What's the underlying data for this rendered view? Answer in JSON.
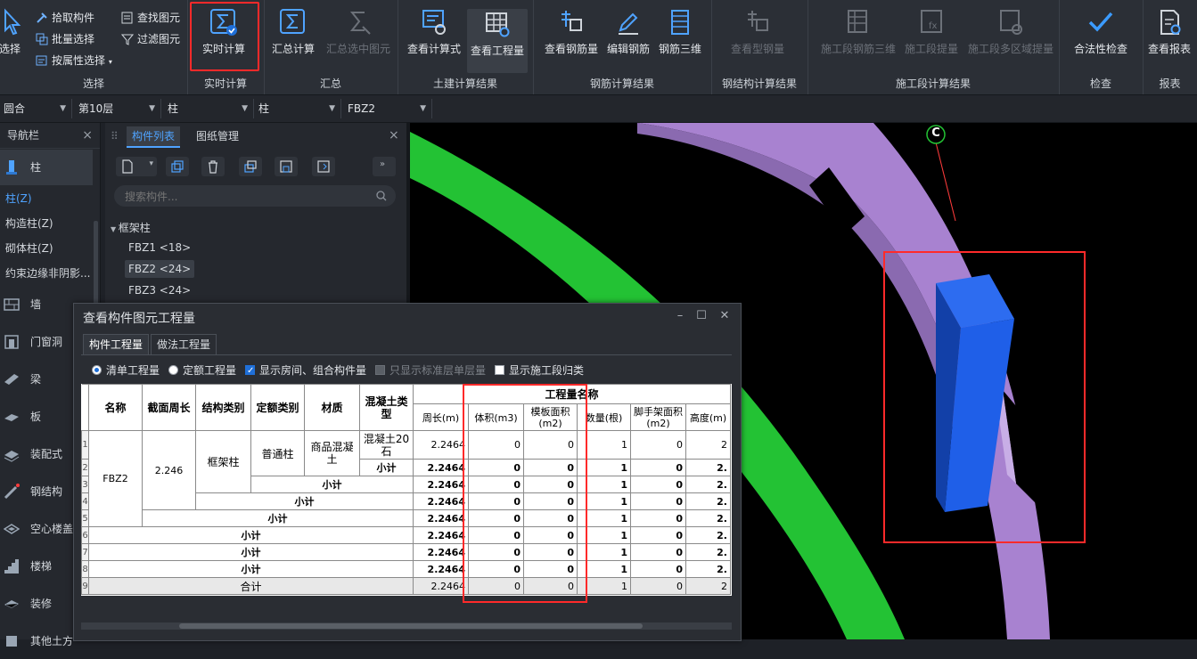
{
  "ribbon": {
    "groups": [
      {
        "caption": "选择",
        "big": [
          {
            "label": "选择"
          }
        ],
        "small": [
          {
            "label": "拾取构件"
          },
          {
            "label": "批量选择"
          },
          {
            "label": "按属性选择"
          },
          {
            "label": "查找图元"
          },
          {
            "label": "过滤图元"
          }
        ]
      },
      {
        "caption": "实时计算",
        "big": [
          {
            "label": "实时计算"
          }
        ]
      },
      {
        "caption": "汇总",
        "big": [
          {
            "label": "汇总计算"
          },
          {
            "label": "汇总选中图元"
          }
        ]
      },
      {
        "caption": "土建计算结果",
        "big": [
          {
            "label": "查看计算式"
          },
          {
            "label": "查看工程量"
          }
        ]
      },
      {
        "caption": "钢筋计算结果",
        "big": [
          {
            "label": "查看钢筋量"
          },
          {
            "label": "编辑钢筋"
          },
          {
            "label": "钢筋三维"
          }
        ]
      },
      {
        "caption": "钢结构计算结果",
        "big": [
          {
            "label": "查看型钢量"
          }
        ]
      },
      {
        "caption": "施工段计算结果",
        "big": [
          {
            "label": "施工段钢筋三维"
          },
          {
            "label": "施工段提量"
          },
          {
            "label": "施工段多区域提量"
          }
        ]
      },
      {
        "caption": "检查",
        "big": [
          {
            "label": "合法性检查"
          }
        ]
      },
      {
        "caption": "报表",
        "big": [
          {
            "label": "查看报表"
          }
        ]
      }
    ],
    "highlight_color": "#ff2a2a"
  },
  "dropdowns": [
    "圆合",
    "第10层",
    "柱",
    "柱",
    "FBZ2"
  ],
  "nav": {
    "title": "导航栏",
    "selected_category": "柱",
    "sub_items": [
      "柱(Z)",
      "构造柱(Z)",
      "砌体柱(Z)",
      "约束边缘非阴影..."
    ],
    "categories": [
      "墙",
      "门窗洞",
      "梁",
      "板",
      "装配式",
      "钢结构",
      "空心楼盖",
      "楼梯",
      "装修",
      "其他土方"
    ]
  },
  "component_list": {
    "tabs": [
      "构件列表",
      "图纸管理"
    ],
    "search_placeholder": "搜索构件...",
    "tree_root": "框架柱",
    "items": [
      "FBZ1 <18>",
      "FBZ2 <24>",
      "FBZ3 <24>"
    ],
    "selected_index": 1
  },
  "viewport": {
    "axis_label": "C"
  },
  "dialog": {
    "title": "查看构件图元工程量",
    "tabs": [
      "构件工程量",
      "做法工程量"
    ],
    "options": [
      {
        "label": "清单工程量",
        "type": "radio",
        "checked": true
      },
      {
        "label": "定额工程量",
        "type": "radio",
        "checked": false
      },
      {
        "label": "显示房间、组合构件量",
        "type": "check",
        "checked": true
      },
      {
        "label": "只显示标准层单层量",
        "type": "check",
        "checked": false,
        "disabled": true
      },
      {
        "label": "显示施工段归类",
        "type": "check",
        "checked": false
      }
    ],
    "table": {
      "headers": {
        "name": "名称",
        "perimeter": "截面周长",
        "struct_type": "结构类别",
        "quota_type": "定额类别",
        "material": "材质",
        "concrete_type": "混凝土类型",
        "group": "工程量名称",
        "cols": [
          "周长(m)",
          "体积(m3)",
          "模板面积(m2)",
          "数量(根)",
          "脚手架面积(m2)",
          "高度(m)"
        ]
      },
      "first": {
        "name": "FBZ2",
        "perimeter": "2.246",
        "struct_type": "框架柱",
        "quota_type": "普通柱",
        "material": "商品混凝土",
        "concrete_type": "混凝土20石"
      },
      "subtotal": "小计",
      "total": "合计",
      "row_numbers": [
        "1",
        "2",
        "3",
        "4",
        "5",
        "6",
        "7",
        "8",
        "9"
      ],
      "rows": [
        [
          "2.2464",
          "0",
          "0",
          "1",
          "0",
          "2"
        ],
        [
          "2.2464",
          "0",
          "0",
          "1",
          "0",
          "2."
        ],
        [
          "2.2464",
          "0",
          "0",
          "1",
          "0",
          "2."
        ],
        [
          "2.2464",
          "0",
          "0",
          "1",
          "0",
          "2."
        ],
        [
          "2.2464",
          "0",
          "0",
          "1",
          "0",
          "2."
        ],
        [
          "2.2464",
          "0",
          "0",
          "1",
          "0",
          "2."
        ],
        [
          "2.2464",
          "0",
          "0",
          "1",
          "0",
          "2."
        ],
        [
          "2.2464",
          "0",
          "0",
          "1",
          "0",
          "2."
        ],
        [
          "2.2464",
          "0",
          "0",
          "1",
          "0",
          "2"
        ]
      ]
    }
  }
}
